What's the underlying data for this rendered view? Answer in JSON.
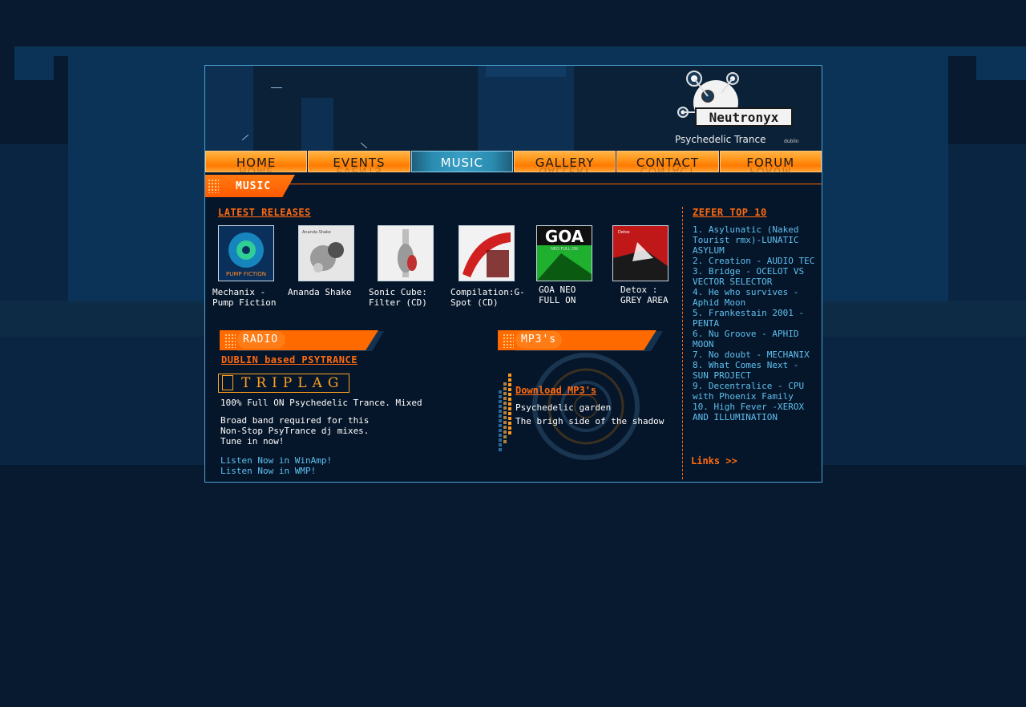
{
  "colors": {
    "accent": "#ff6a00",
    "link": "#5ec0f0",
    "frame_border": "#4aa3d4",
    "background": "#071a30"
  },
  "logo": {
    "main": "Neutronyx",
    "sub": "Psychedelic Trance",
    "city": "dublin"
  },
  "nav": {
    "items": [
      {
        "label": "HOME",
        "active": false
      },
      {
        "label": "EVENTS",
        "active": false
      },
      {
        "label": "MUSIC",
        "active": true
      },
      {
        "label": "GALLERY",
        "active": false
      },
      {
        "label": "CONTACT",
        "active": false
      },
      {
        "label": "FORUM",
        "active": false
      }
    ]
  },
  "section": {
    "title": "MUSIC"
  },
  "latest": {
    "heading": "LATEST RELEASES",
    "releases": [
      {
        "caption": "Mechanix -\nPump Fiction",
        "cover_text": "PUMP FICTION",
        "cover_colors": [
          "#0a2f5a",
          "#1ec0ff",
          "#34e08a"
        ]
      },
      {
        "caption": "Ananda Shake",
        "cover_text": "Ananda Shake",
        "cover_colors": [
          "#e6e6e6",
          "#9a9a9a",
          "#505050"
        ]
      },
      {
        "caption": "Sonic Cube:\nFilter (CD)",
        "cover_text": "",
        "cover_colors": [
          "#f0f0f0",
          "#bdbdbd",
          "#c03030"
        ]
      },
      {
        "caption": "Compilation:G-\nSpot (CD)",
        "cover_text": "",
        "cover_colors": [
          "#f2f2f2",
          "#d02020",
          "#6a0a0a"
        ]
      },
      {
        "caption": "GOA NEO\nFULL ON",
        "cover_text": "GOA",
        "cover_subtext": "NEO FULL ON",
        "cover_colors": [
          "#101010",
          "#1fb030",
          "#0a5a12"
        ]
      },
      {
        "caption": "Detox :\nGREY AREA",
        "cover_text": "Detox",
        "cover_colors": [
          "#c01818",
          "#1a1a1a",
          "#ffffff"
        ]
      }
    ]
  },
  "radio": {
    "tab_label": "RADIO",
    "subheading": "DUBLIN based PSYTRANCE",
    "logo_text": "TRIPLAG",
    "line1": "100% Full ON Psychedelic Trance. Mixed",
    "line2": "Broad band required for this\nNon-Stop PsyTrance dj mixes.\nTune in now!",
    "links": [
      "Listen Now in WinAmp!",
      "Listen Now in WMP!"
    ]
  },
  "mp3": {
    "tab_label": "MP3's",
    "download_label": "Download MP3's",
    "tracks": [
      "Psychedelic garden",
      "The brigh side of the shadow"
    ]
  },
  "top10": {
    "heading": "ZEFER TOP 10",
    "items": [
      "1. Asylunatic (Naked Tourist rmx)-LUNATIC ASYLUM",
      "2. Creation - AUDIO TEC",
      "3. Bridge - OCELOT VS VECTOR SELECTOR",
      "4. He who survives - Aphid Moon",
      "5. Frankestain 2001 - PENTA",
      "6. Nu Groove - APHID MOON",
      "7. No doubt - MECHANIX",
      "8.  What Comes Next - SUN PROJECT",
      "9. Decentralice - CPU with Phoenix Family",
      "10. High Fever -XEROX AND ILLUMINATION"
    ],
    "links_label": "Links >>"
  }
}
